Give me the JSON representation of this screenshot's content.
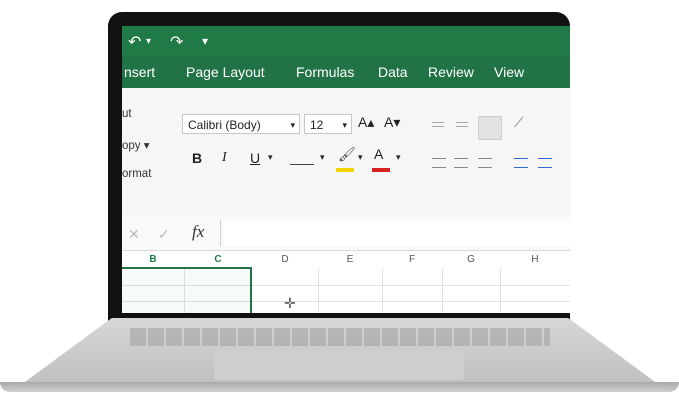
{
  "quick_access": {
    "undo": "↶",
    "redo": "↷",
    "customize": "▾"
  },
  "tabs": [
    {
      "label": "nsert"
    },
    {
      "label": "Page Layout"
    },
    {
      "label": "Formulas"
    },
    {
      "label": "Data"
    },
    {
      "label": "Review"
    },
    {
      "label": "View"
    }
  ],
  "clipboard": {
    "cut": "ut",
    "copy": "opy ▾",
    "format": "ormat"
  },
  "font": {
    "name": "Calibri (Body)",
    "size": "12",
    "grow": "A▴",
    "shrink": "A▾"
  },
  "format_buttons": {
    "bold": "B",
    "italic": "I",
    "underline": "U"
  },
  "formula_bar": {
    "fx": "fx",
    "cancel": "✕",
    "confirm": "✓"
  },
  "columns": [
    "B",
    "C",
    "D",
    "E",
    "F",
    "G",
    "H"
  ],
  "colors": {
    "excel_green": "#217346",
    "fill_yellow": "#f2d400",
    "font_red": "#d92020"
  }
}
